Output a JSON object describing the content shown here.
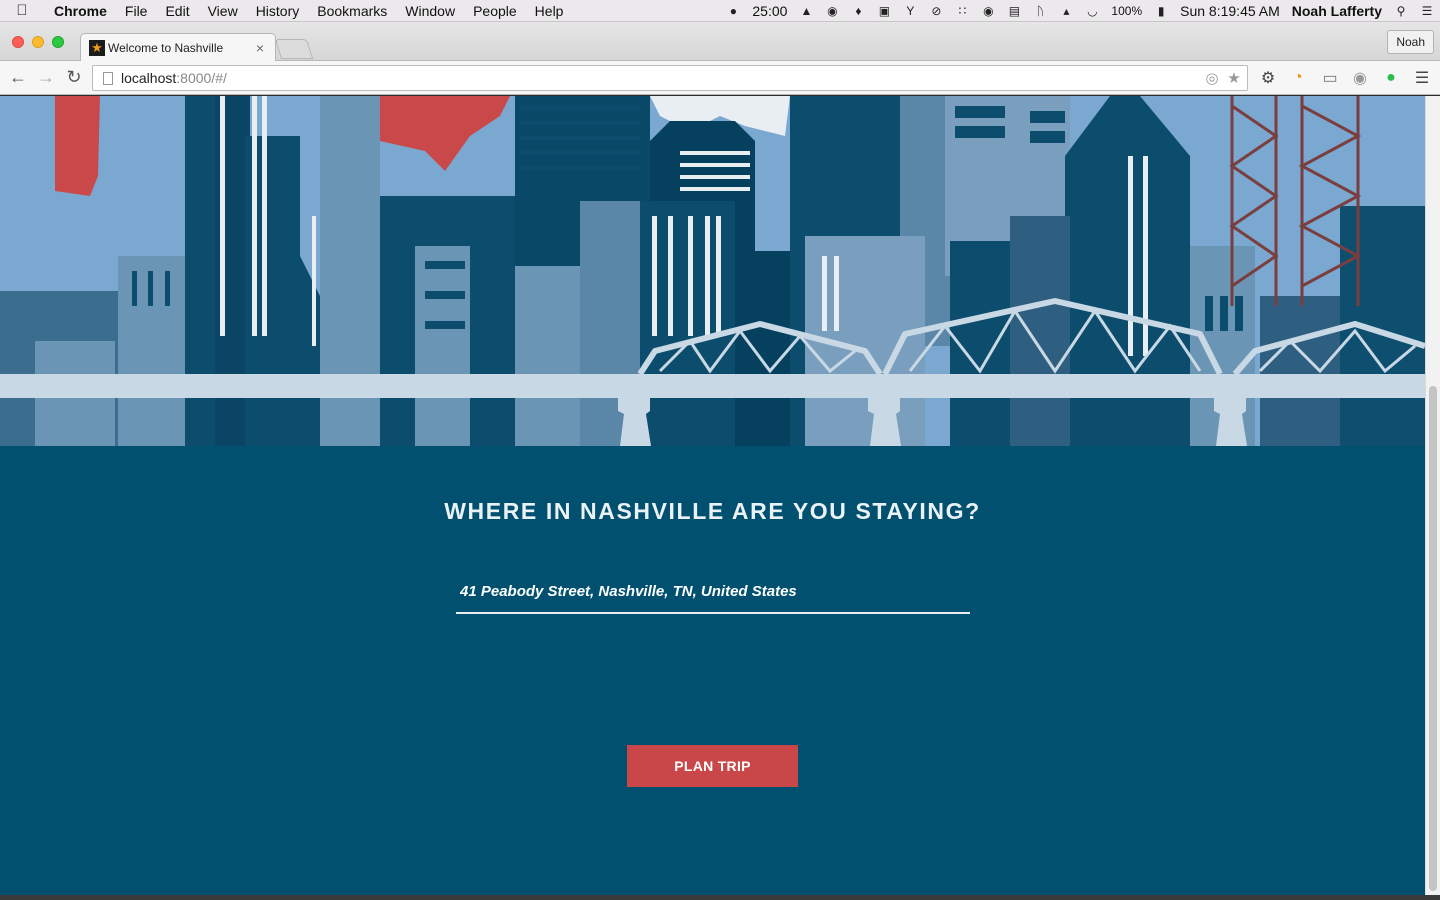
{
  "menubar": {
    "app": "Chrome",
    "items": [
      "File",
      "Edit",
      "View",
      "History",
      "Bookmarks",
      "Window",
      "People",
      "Help"
    ],
    "timer": "25:00",
    "battery": "100%",
    "clock": "Sun 8:19:45 AM",
    "user": "Noah Lafferty"
  },
  "browser": {
    "tab_title": "Welcome to Nashville",
    "profile": "Noah",
    "url_host": "localhost",
    "url_path": ":8000/#/"
  },
  "page": {
    "heading": "WHERE IN NASHVILLE ARE YOU STAYING?",
    "address_value": "41 Peabody Street, Nashville, TN, United States",
    "plan_button": "PLAN TRIP"
  },
  "colors": {
    "page_bg": "#01506f",
    "button": "#c94748",
    "sky": "#7aa8d0",
    "bridge": "#c8d8e4"
  }
}
